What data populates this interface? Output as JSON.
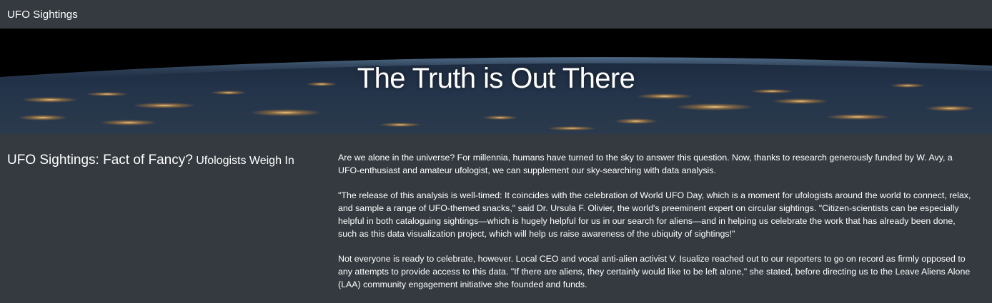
{
  "navbar": {
    "brand": "UFO Sightings"
  },
  "hero": {
    "title": "The Truth is Out There"
  },
  "article": {
    "heading_main": "UFO Sightings: Fact of Fancy?",
    "heading_sub": "Ufologists Weigh In",
    "paragraphs": [
      "Are we alone in the universe? For millennia, humans have turned to the sky to answer this question. Now, thanks to research generously funded by W. Avy, a UFO-enthusiast and amateur ufologist, we can supplement our sky-searching with data analysis.",
      "\"The release of this analysis is well-timed: It coincides with the celebration of World UFO Day, which is a moment for ufologists around the world to connect, relax, and sample a range of UFO-themed snacks,\" said Dr. Ursula F. Olivier, the world's preeminent expert on circular sightings. \"Citizen-scientists can be especially helpful in both cataloguing sightings—which is hugely helpful for us in our search for aliens—and in helping us celebrate the work that has already been done, such as this data visualization project, which will help us raise awareness of the ubiquity of sightings!\"",
      "Not everyone is ready to celebrate, however. Local CEO and vocal anti-alien activist V. Isualize reached out to our reporters to go on record as firmly opposed to any attempts to provide access to this data. \"If there are aliens, they certainly would like to be left alone,\" she stated, before directing us to the Leave Aliens Alone (LAA) community engagement initiative she founded and funds."
    ]
  },
  "colors": {
    "background": "#343a40",
    "text": "#ffffff"
  }
}
